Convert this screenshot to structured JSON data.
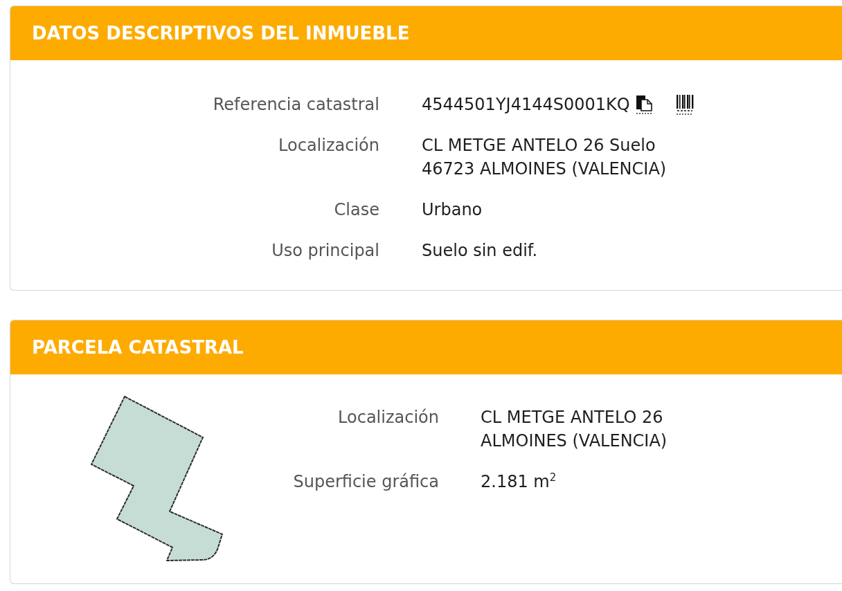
{
  "sections": [
    {
      "kind": "details",
      "title": "DATOS DESCRIPTIVOS DEL INMUEBLE",
      "fields": [
        {
          "label": "Referencia catastral",
          "lines": [
            "4544501YJ4144S0001KQ"
          ],
          "actions": [
            {
              "kind": "copy"
            },
            {
              "kind": "barcode"
            }
          ]
        },
        {
          "label": "Localización",
          "lines": [
            "CL METGE ANTELO 26 Suelo",
            "46723 ALMOINES (VALENCIA)"
          ]
        },
        {
          "label": "Clase",
          "lines": [
            "Urbano"
          ]
        },
        {
          "label": "Uso principal",
          "lines": [
            "Suelo sin edif."
          ]
        }
      ]
    },
    {
      "kind": "parcel",
      "title": "PARCELA CATASTRAL",
      "fields": [
        {
          "label": "Localización",
          "lines": [
            "CL METGE ANTELO 26",
            "ALMOINES (VALENCIA)"
          ]
        },
        {
          "label": "Superficie gráfica",
          "lines": [
            "2.181 m$^{2}$"
          ]
        }
      ]
    }
  ]
}
